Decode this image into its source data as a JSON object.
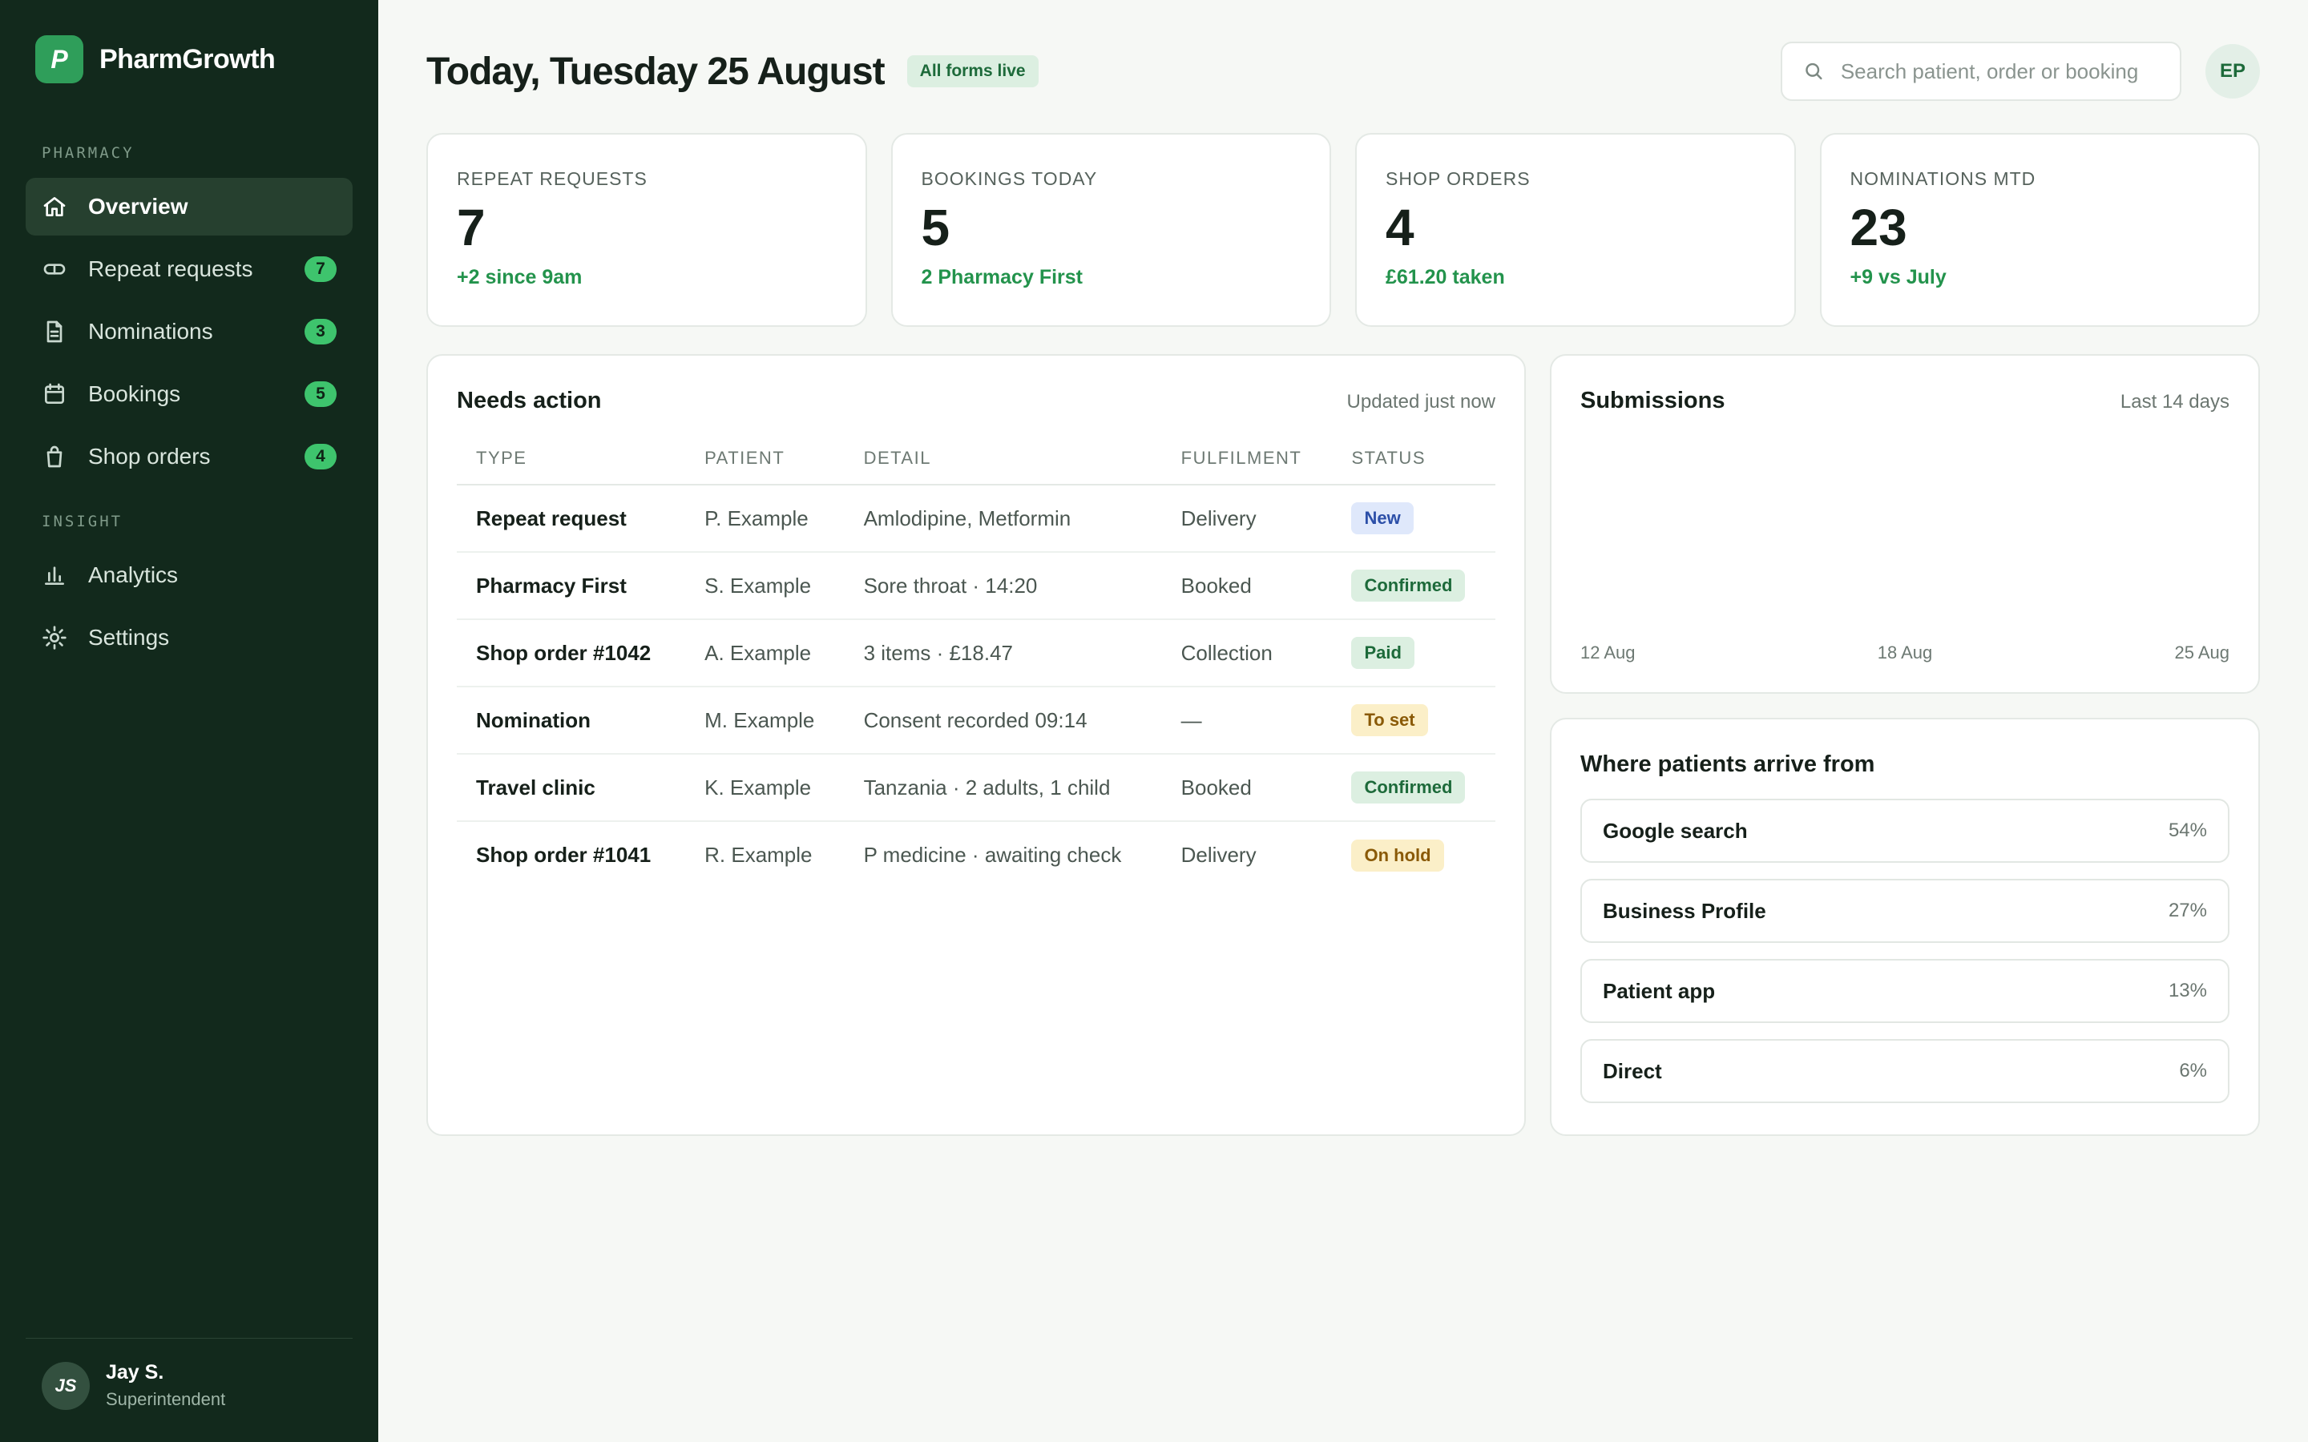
{
  "brand": {
    "logo_letter": "P",
    "name": "PharmGrowth"
  },
  "sidebar": {
    "sections": [
      {
        "label": "PHARMACY"
      },
      {
        "label": "INSIGHT"
      }
    ],
    "items": [
      {
        "label": "Overview",
        "icon": "home-icon",
        "badge": ""
      },
      {
        "label": "Repeat requests",
        "icon": "pill-icon",
        "badge": "7"
      },
      {
        "label": "Nominations",
        "icon": "document-icon",
        "badge": "3"
      },
      {
        "label": "Bookings",
        "icon": "calendar-icon",
        "badge": "5"
      },
      {
        "label": "Shop orders",
        "icon": "bag-icon",
        "badge": "4"
      },
      {
        "label": "Analytics",
        "icon": "bar-chart-icon",
        "badge": ""
      },
      {
        "label": "Settings",
        "icon": "gear-icon",
        "badge": ""
      }
    ],
    "user": {
      "initials": "JS",
      "name": "Jay S.",
      "role": "Superintendent"
    }
  },
  "header": {
    "title": "Today, Tuesday 25 August",
    "live_badge": "All forms live",
    "search_placeholder": "Search patient, order or booking",
    "avatar_initials": "EP"
  },
  "stats": [
    {
      "label": "REPEAT REQUESTS",
      "value": "7",
      "delta": "+2 since 9am"
    },
    {
      "label": "BOOKINGS TODAY",
      "value": "5",
      "delta": "2 Pharmacy First"
    },
    {
      "label": "SHOP ORDERS",
      "value": "4",
      "delta": "£61.20 taken"
    },
    {
      "label": "NOMINATIONS MTD",
      "value": "23",
      "delta": "+9 vs July"
    }
  ],
  "needs_action": {
    "title": "Needs action",
    "meta": "Updated just now",
    "columns": [
      "TYPE",
      "PATIENT",
      "DETAIL",
      "FULFILMENT",
      "STATUS"
    ],
    "rows": [
      {
        "type": "Repeat request",
        "patient": "P. Example",
        "detail": "Amlodipine, Metformin",
        "fulfilment": "Delivery",
        "status": "New",
        "status_kind": "new"
      },
      {
        "type": "Pharmacy First",
        "patient": "S. Example",
        "detail": "Sore throat · 14:20",
        "fulfilment": "Booked",
        "status": "Confirmed",
        "status_kind": "ok"
      },
      {
        "type": "Shop order #1042",
        "patient": "A. Example",
        "detail": "3 items · £18.47",
        "fulfilment": "Collection",
        "status": "Paid",
        "status_kind": "ok"
      },
      {
        "type": "Nomination",
        "patient": "M. Example",
        "detail": "Consent recorded 09:14",
        "fulfilment": "—",
        "status": "To set",
        "status_kind": "warn"
      },
      {
        "type": "Travel clinic",
        "patient": "K. Example",
        "detail": "Tanzania · 2 adults, 1 child",
        "fulfilment": "Booked",
        "status": "Confirmed",
        "status_kind": "ok"
      },
      {
        "type": "Shop order #1041",
        "patient": "R. Example",
        "detail": "P medicine · awaiting check",
        "fulfilment": "Delivery",
        "status": "On hold",
        "status_kind": "warn"
      }
    ]
  },
  "submissions": {
    "title": "Submissions",
    "meta": "Last 14 days",
    "axis_labels": [
      "12 Aug",
      "18 Aug",
      "25 Aug"
    ]
  },
  "arrivals": {
    "title": "Where patients arrive from",
    "sources": [
      {
        "name": "Google search",
        "pct": "54%"
      },
      {
        "name": "Business Profile",
        "pct": "27%"
      },
      {
        "name": "Patient app",
        "pct": "13%"
      },
      {
        "name": "Direct",
        "pct": "6%"
      }
    ]
  },
  "colors": {
    "sidebar_bg": "#12291c",
    "accent": "#3ec46d",
    "positive": "#23934c"
  }
}
